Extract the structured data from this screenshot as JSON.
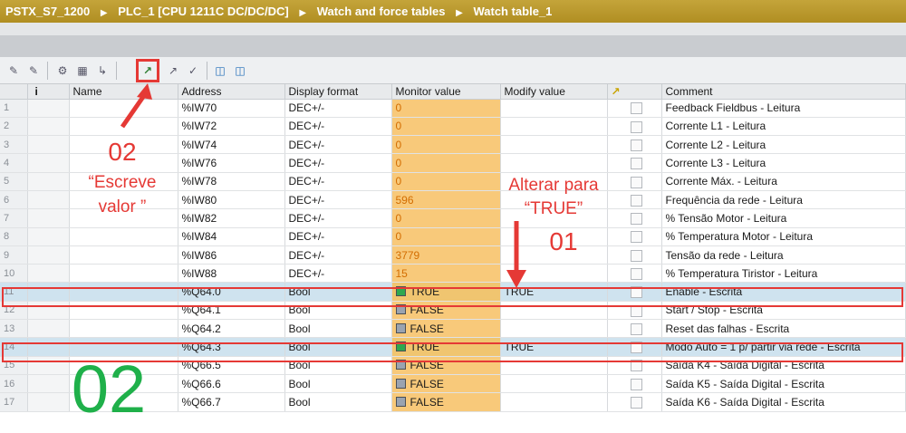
{
  "breadcrumb": [
    "PSTX_S7_1200",
    "PLC_1 [CPU 1211C DC/DC/DC]",
    "Watch and force tables",
    "Watch table_1"
  ],
  "colors": {
    "accent_title": "#b8962a",
    "monitor_col": "#f8c97a",
    "annotation_red": "#e53935",
    "annotation_green": "#1fb04a",
    "selected_row": "#cfe3ef"
  },
  "toolbar": {
    "icons": [
      "insert-row-icon",
      "add-row-icon",
      "rename-icon",
      "display-format-icon",
      "monitor-once-icon",
      "modify-now-icon",
      "modify-trigger-icon",
      "force-icon",
      "monitor-all-icon",
      "monitor-now-icon"
    ]
  },
  "table": {
    "headers": {
      "num": "",
      "info": "i",
      "name": "Name",
      "address": "Address",
      "format": "Display format",
      "monitor": "Monitor value",
      "modify": "Modify value",
      "flag": "",
      "comment": "Comment"
    },
    "rows": [
      {
        "n": "1",
        "name": "",
        "address": "%IW70",
        "format": "DEC+/-",
        "monitor": "0",
        "modify": "",
        "comment": "Feedback Fieldbus - Leitura"
      },
      {
        "n": "2",
        "name": "",
        "address": "%IW72",
        "format": "DEC+/-",
        "monitor": "0",
        "modify": "",
        "comment": "Corrente L1 - Leitura"
      },
      {
        "n": "3",
        "name": "",
        "address": "%IW74",
        "format": "DEC+/-",
        "monitor": "0",
        "modify": "",
        "comment": "Corrente L2 - Leitura"
      },
      {
        "n": "4",
        "name": "",
        "address": "%IW76",
        "format": "DEC+/-",
        "monitor": "0",
        "modify": "",
        "comment": "Corrente L3 - Leitura"
      },
      {
        "n": "5",
        "name": "",
        "address": "%IW78",
        "format": "DEC+/-",
        "monitor": "0",
        "modify": "",
        "comment": "Corrente Máx. - Leitura"
      },
      {
        "n": "6",
        "name": "",
        "address": "%IW80",
        "format": "DEC+/-",
        "monitor": "596",
        "modify": "",
        "comment": "Frequência da rede - Leitura"
      },
      {
        "n": "7",
        "name": "",
        "address": "%IW82",
        "format": "DEC+/-",
        "monitor": "0",
        "modify": "",
        "comment": "% Tensão Motor - Leitura"
      },
      {
        "n": "8",
        "name": "",
        "address": "%IW84",
        "format": "DEC+/-",
        "monitor": "0",
        "modify": "",
        "comment": "% Temperatura Motor - Leitura"
      },
      {
        "n": "9",
        "name": "",
        "address": "%IW86",
        "format": "DEC+/-",
        "monitor": "3779",
        "modify": "",
        "comment": "Tensão da rede - Leitura"
      },
      {
        "n": "10",
        "name": "",
        "address": "%IW88",
        "format": "DEC+/-",
        "monitor": "15",
        "modify": "",
        "comment": "% Temperatura Tiristor - Leitura"
      },
      {
        "n": "11",
        "name": "",
        "address": "%Q64.0",
        "format": "Bool",
        "monitor": "TRUE",
        "modify": "TRUE",
        "comment": "Enable - Escrita",
        "bool": "true",
        "selected": true
      },
      {
        "n": "12",
        "name": "",
        "address": "%Q64.1",
        "format": "Bool",
        "monitor": "FALSE",
        "modify": "",
        "comment": "Start / Stop - Escrita",
        "bool": "false"
      },
      {
        "n": "13",
        "name": "",
        "address": "%Q64.2",
        "format": "Bool",
        "monitor": "FALSE",
        "modify": "",
        "comment": "Reset das falhas - Escrita",
        "bool": "false"
      },
      {
        "n": "14",
        "name": "",
        "address": "%Q64.3",
        "format": "Bool",
        "monitor": "TRUE",
        "modify": "TRUE",
        "comment": "Modo Auto = 1 p/ partir via rede - Escrita",
        "bool": "true",
        "selected": true
      },
      {
        "n": "15",
        "name": "",
        "address": "%Q66.5",
        "format": "Bool",
        "monitor": "FALSE",
        "modify": "",
        "comment": "Saída K4 - Saída Digital - Escrita",
        "bool": "false"
      },
      {
        "n": "16",
        "name": "",
        "address": "%Q66.6",
        "format": "Bool",
        "monitor": "FALSE",
        "modify": "",
        "comment": "Saída K5 - Saída Digital - Escrita",
        "bool": "false"
      },
      {
        "n": "17",
        "name": "",
        "address": "%Q66.7",
        "format": "Bool",
        "monitor": "FALSE",
        "modify": "",
        "comment": "Saída K6 - Saída Digital - Escrita",
        "bool": "false"
      }
    ]
  },
  "annotations": {
    "step02_num": "02",
    "step02_line1": "“Escreve",
    "step02_line2": "valor ”",
    "step01_line1": "Alterar para",
    "step01_line2": "“TRUE”",
    "step01_num": "01",
    "big_green": "02"
  }
}
